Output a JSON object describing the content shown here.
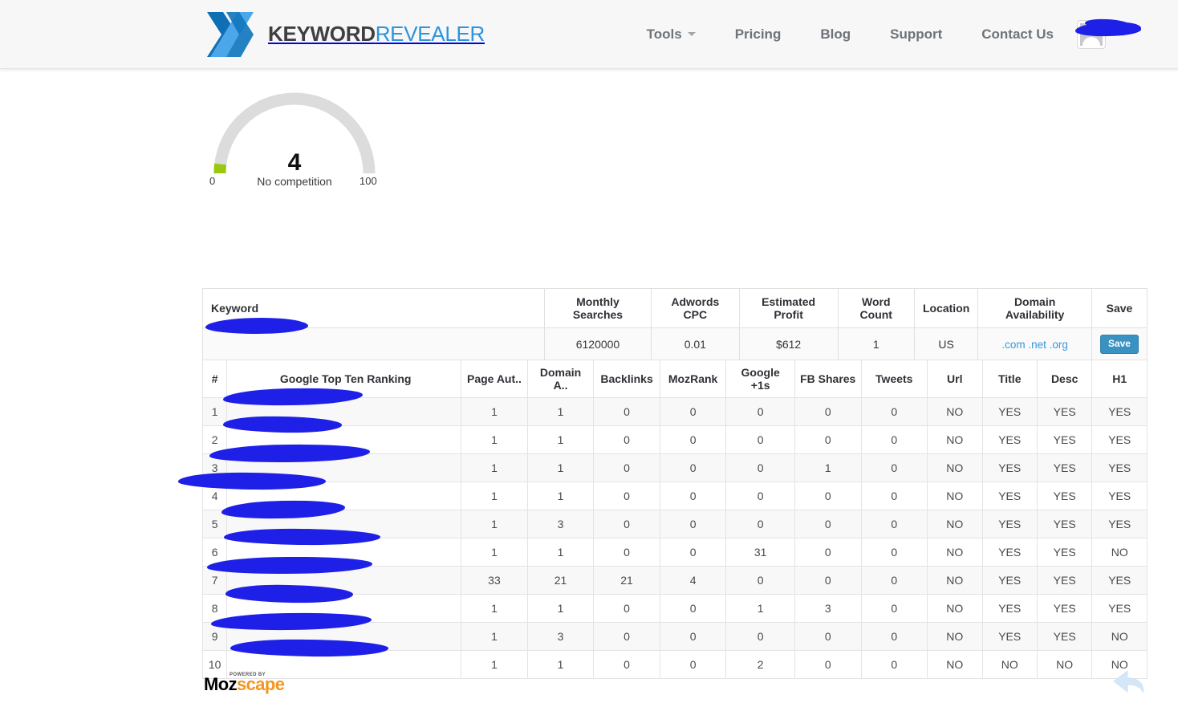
{
  "header": {
    "brand_bold": "KEYWORD",
    "brand_light": "REVEALER",
    "logo_icon": "keyword-revealer-k-logo",
    "nav": [
      {
        "label": "Tools",
        "has_caret": true
      },
      {
        "label": "Pricing",
        "has_caret": false
      },
      {
        "label": "Blog",
        "has_caret": false
      },
      {
        "label": "Support",
        "has_caret": false
      },
      {
        "label": "Contact Us",
        "has_caret": false
      }
    ],
    "user": {
      "name": "",
      "avatar_icon": "user-avatar-icon",
      "caret_icon": "chevron-down-icon"
    }
  },
  "gauge": {
    "value": "4",
    "label": "No competition",
    "min": "0",
    "max": "100",
    "track_color": "#dcdcdc",
    "fill_color": "#9ac80e",
    "percent": 4
  },
  "keyword_table": {
    "headers": [
      "Keyword",
      "Monthly Searches",
      "Adwords CPC",
      "Estimated Profit",
      "Word Count",
      "Location",
      "Domain Availability",
      "Save"
    ],
    "row": {
      "keyword": "",
      "monthly_searches": "6120000",
      "adwords_cpc": "0.01",
      "estimated_profit": "$612",
      "word_count": "1",
      "location": "US",
      "domain_availability": ".com .net .org",
      "save_label": "Save"
    }
  },
  "ranking_table": {
    "headers": [
      "#",
      "Google Top Ten Ranking",
      "Page Aut..",
      "Domain A..",
      "Backlinks",
      "MozRank",
      "Google +1s",
      "FB Shares",
      "Tweets",
      "Url",
      "Title",
      "Desc",
      "H1"
    ],
    "rows": [
      {
        "num": "1",
        "site": "",
        "page_authority": "1",
        "domain_authority": "1",
        "backlinks": "0",
        "mozrank": "0",
        "google_plus": "0",
        "fb_shares": "0",
        "tweets": "0",
        "url": "NO",
        "title": "YES",
        "desc": "YES",
        "h1": "YES"
      },
      {
        "num": "2",
        "site": "",
        "page_authority": "1",
        "domain_authority": "1",
        "backlinks": "0",
        "mozrank": "0",
        "google_plus": "0",
        "fb_shares": "0",
        "tweets": "0",
        "url": "NO",
        "title": "YES",
        "desc": "YES",
        "h1": "YES"
      },
      {
        "num": "3",
        "site": "",
        "page_authority": "1",
        "domain_authority": "1",
        "backlinks": "0",
        "mozrank": "0",
        "google_plus": "0",
        "fb_shares": "1",
        "tweets": "0",
        "url": "NO",
        "title": "YES",
        "desc": "YES",
        "h1": "YES"
      },
      {
        "num": "4",
        "site": "",
        "page_authority": "1",
        "domain_authority": "1",
        "backlinks": "0",
        "mozrank": "0",
        "google_plus": "0",
        "fb_shares": "0",
        "tweets": "0",
        "url": "NO",
        "title": "YES",
        "desc": "YES",
        "h1": "YES"
      },
      {
        "num": "5",
        "site": "",
        "page_authority": "1",
        "domain_authority": "3",
        "backlinks": "0",
        "mozrank": "0",
        "google_plus": "0",
        "fb_shares": "0",
        "tweets": "0",
        "url": "NO",
        "title": "YES",
        "desc": "YES",
        "h1": "YES"
      },
      {
        "num": "6",
        "site": "",
        "page_authority": "1",
        "domain_authority": "1",
        "backlinks": "0",
        "mozrank": "0",
        "google_plus": "31",
        "fb_shares": "0",
        "tweets": "0",
        "url": "NO",
        "title": "YES",
        "desc": "YES",
        "h1": "NO"
      },
      {
        "num": "7",
        "site": "",
        "page_authority": "33",
        "domain_authority": "21",
        "backlinks": "21",
        "mozrank": "4",
        "google_plus": "0",
        "fb_shares": "0",
        "tweets": "0",
        "url": "NO",
        "title": "YES",
        "desc": "YES",
        "h1": "YES"
      },
      {
        "num": "8",
        "site": "",
        "page_authority": "1",
        "domain_authority": "1",
        "backlinks": "0",
        "mozrank": "0",
        "google_plus": "1",
        "fb_shares": "3",
        "tweets": "0",
        "url": "NO",
        "title": "YES",
        "desc": "YES",
        "h1": "YES"
      },
      {
        "num": "9",
        "site": "",
        "page_authority": "1",
        "domain_authority": "3",
        "backlinks": "0",
        "mozrank": "0",
        "google_plus": "0",
        "fb_shares": "0",
        "tweets": "0",
        "url": "NO",
        "title": "YES",
        "desc": "YES",
        "h1": "NO"
      },
      {
        "num": "10",
        "site": "",
        "page_authority": "1",
        "domain_authority": "1",
        "backlinks": "0",
        "mozrank": "0",
        "google_plus": "2",
        "fb_shares": "0",
        "tweets": "0",
        "url": "NO",
        "title": "NO",
        "desc": "NO",
        "h1": "NO"
      }
    ]
  },
  "footer": {
    "powered_by": "POWERED BY",
    "moz": "Moz",
    "scape": "scape",
    "reply_icon": "reply-arrow-icon"
  }
}
